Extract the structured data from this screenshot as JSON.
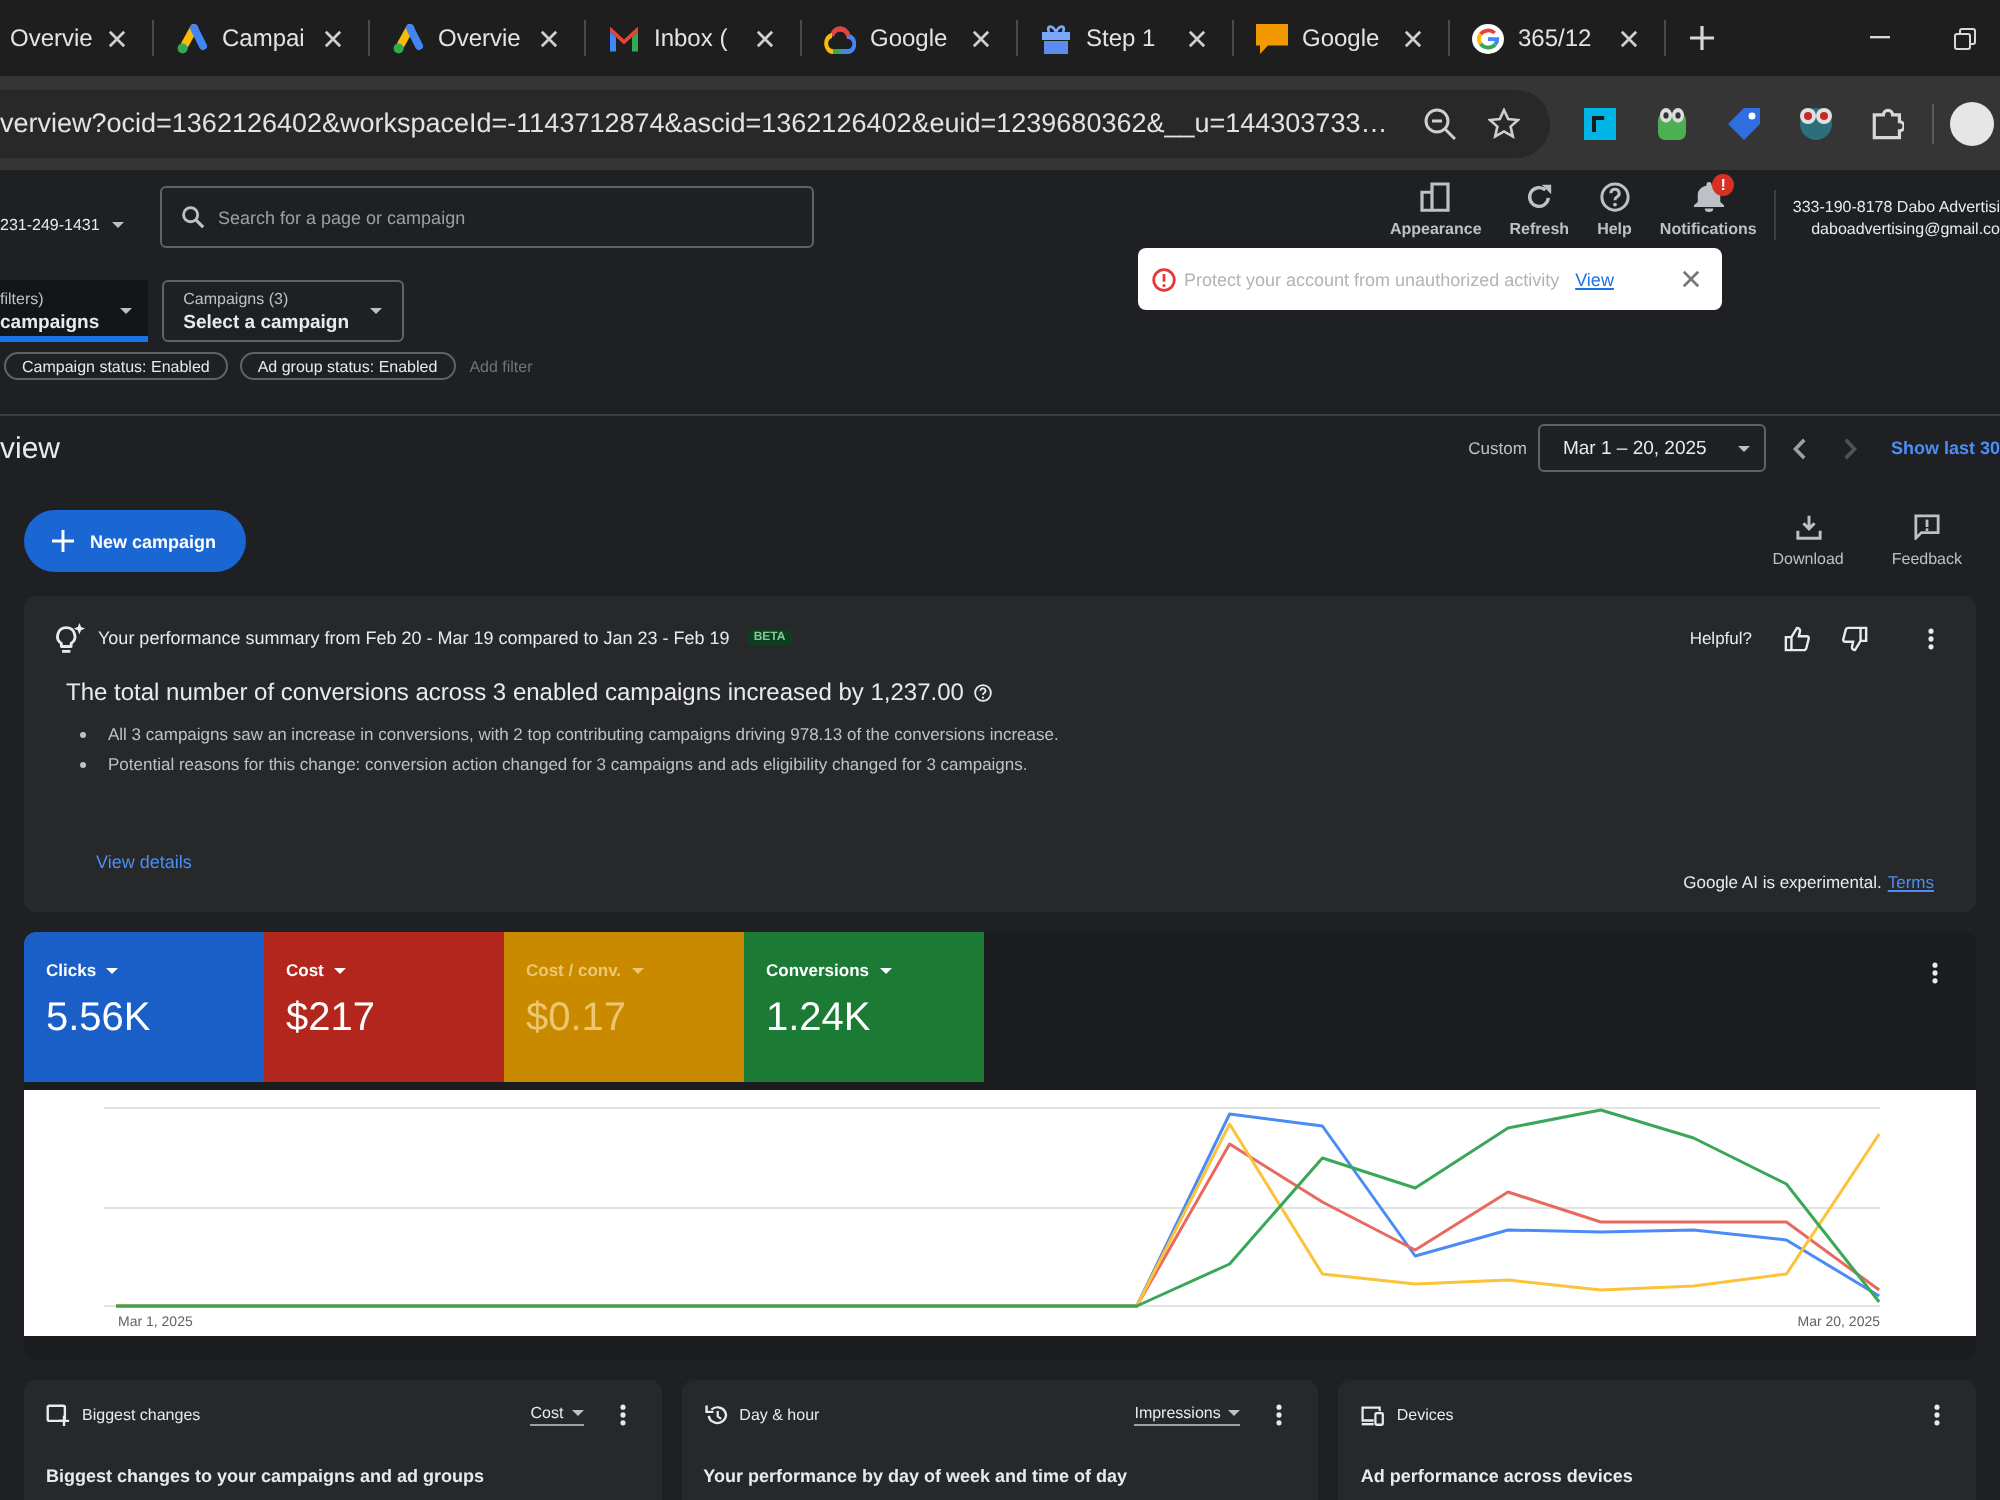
{
  "browser": {
    "tabs": [
      {
        "title": "Overvie",
        "kind": "plain"
      },
      {
        "title": "Campai",
        "kind": "ads"
      },
      {
        "title": "Overvie",
        "kind": "ads"
      },
      {
        "title": "Inbox (",
        "kind": "mail"
      },
      {
        "title": "Google",
        "kind": "cloud"
      },
      {
        "title": "Step 1",
        "kind": "gift"
      },
      {
        "title": "Google",
        "kind": "chat"
      },
      {
        "title": "365/12",
        "kind": "google"
      }
    ],
    "address": "verview?ocid=1362126402&workspaceId=-1143712874&ascid=1362126402&euid=1239680362&__u=144303733…"
  },
  "header": {
    "account": "231-249-1431",
    "search": {
      "placeholder": "Search for a page or campaign"
    },
    "actions": [
      {
        "label": "Appearance",
        "kind": "appearance"
      },
      {
        "label": "Refresh",
        "kind": "refresh"
      },
      {
        "label": "Help",
        "kind": "help"
      },
      {
        "label": "Notifications",
        "kind": "bell",
        "badge": "!"
      }
    ],
    "user": {
      "line_1": "333-190-8178 Dabo Advertisi",
      "line_2": "daboadvertising@gmail.co"
    }
  },
  "filters": {
    "views": [
      {
        "label": "filters)",
        "value": "campaigns",
        "selected": true
      },
      {
        "label": "Campaigns (3)",
        "value": "Select a campaign",
        "selected": false
      }
    ],
    "chips": [
      "Campaign status: Enabled",
      "Ad group status: Enabled"
    ],
    "add_filter": "Add filter"
  },
  "toast": {
    "message": "Protect your account from unauthorized activity",
    "link": "View"
  },
  "overview": {
    "title": "view",
    "range_label": "Custom",
    "date_range": "Mar 1 – 20, 2025",
    "nav": [
      {
        "kind": "previous",
        "disabled": false
      },
      {
        "kind": "next",
        "disabled": true
      }
    ],
    "show_last": "Show last 30",
    "new_campaign": "New campaign",
    "tools": [
      {
        "label": "Download",
        "kind": "download"
      },
      {
        "label": "Feedback",
        "kind": "feedback"
      }
    ]
  },
  "summary": {
    "heading": "Your performance summary from Feb 20 - Mar 19 compared to Jan 23 - Feb 19",
    "badge": "BETA",
    "helpful": "Helpful?",
    "headline": "The total number of conversions across 3 enabled campaigns increased by 1,237.00",
    "bullets": [
      "All 3 campaigns saw an increase in conversions, with 2 top contributing campaigns driving 978.13 of the conversions increase.",
      "Potential reasons for this change: conversion action changed for 3 campaigns and ads eligibility changed for 3 campaigns."
    ],
    "link": "View details",
    "disclaimer": "Google AI is experimental.",
    "terms": "Terms"
  },
  "performance": {
    "metrics": [
      {
        "label": "Clicks",
        "value": "5.56K",
        "color": "#1a5fc8",
        "dimmed": false
      },
      {
        "label": "Cost",
        "value": "$217",
        "color": "#b3261e",
        "dimmed": false
      },
      {
        "label": "Cost / conv.",
        "value": "$0.17",
        "color": "#c98a00",
        "dimmed": true
      },
      {
        "label": "Conversions",
        "value": "1.24K",
        "color": "#1b7a34",
        "dimmed": false
      }
    ],
    "axis_labels": [
      "Mar 1, 2025",
      "Mar 20, 2025"
    ]
  },
  "cards": [
    {
      "title": "Biggest changes",
      "kind": "changes",
      "menu": "Cost",
      "subtitle": "Biggest changes to your campaigns and ad groups"
    },
    {
      "title": "Day & hour",
      "kind": "history",
      "menu": "Impressions",
      "subtitle": "Your performance by day of week and time of day"
    },
    {
      "title": "Devices",
      "kind": "devices",
      "subtitle": "Ad performance across devices"
    }
  ]
}
